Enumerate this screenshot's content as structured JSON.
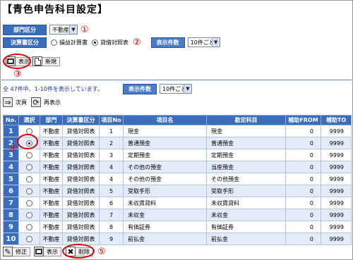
{
  "page_title": "【青色申告科目設定】",
  "filter": {
    "dept_label": "部門区分",
    "dept_value": "不動産",
    "report_label": "決算書区分",
    "report_options": [
      {
        "label": "損益計算書",
        "selected": false
      },
      {
        "label": "貸借対照表",
        "selected": true
      }
    ],
    "count_label": "表示件数",
    "count_value": "10件ごと"
  },
  "annotations": {
    "n1": "①",
    "n2": "②",
    "n3": "③",
    "n4": "④",
    "n5": "⑤"
  },
  "top_buttons": {
    "display": "表示",
    "new": "新規"
  },
  "list_info": {
    "summary": "全 47件中、1-10件を表示しています。",
    "count_label": "表示件数",
    "count_value": "10件ごと",
    "next": "次頁",
    "redisplay": "再表示"
  },
  "table": {
    "headers": [
      "No.",
      "選択",
      "部門",
      "決算書区分",
      "項目No",
      "項目名",
      "勘定科目",
      "補助FROM",
      "補助TO"
    ],
    "rows": [
      {
        "no": "1",
        "selected": false,
        "dept": "不動産",
        "report": "貸借対照表",
        "item_no": "1",
        "item_name": "現金",
        "account": "現金",
        "from": "0",
        "to": "9999"
      },
      {
        "no": "2",
        "selected": true,
        "dept": "不動産",
        "report": "貸借対照表",
        "item_no": "2",
        "item_name": "普通預金",
        "account": "普通預金",
        "from": "0",
        "to": "9999"
      },
      {
        "no": "3",
        "selected": false,
        "dept": "不動産",
        "report": "貸借対照表",
        "item_no": "3",
        "item_name": "定期預金",
        "account": "定期預金",
        "from": "0",
        "to": "9999"
      },
      {
        "no": "4",
        "selected": false,
        "dept": "不動産",
        "report": "貸借対照表",
        "item_no": "4",
        "item_name": "その他の預金",
        "account": "当座預金",
        "from": "0",
        "to": "9999"
      },
      {
        "no": "5",
        "selected": false,
        "dept": "不動産",
        "report": "貸借対照表",
        "item_no": "4",
        "item_name": "その他の預金",
        "account": "その他預金",
        "from": "0",
        "to": "9999"
      },
      {
        "no": "6",
        "selected": false,
        "dept": "不動産",
        "report": "貸借対照表",
        "item_no": "5",
        "item_name": "受取手形",
        "account": "受取手形",
        "from": "0",
        "to": "9999"
      },
      {
        "no": "7",
        "selected": false,
        "dept": "不動産",
        "report": "貸借対照表",
        "item_no": "6",
        "item_name": "未収賃貸料",
        "account": "未収賃貸料",
        "from": "0",
        "to": "9999"
      },
      {
        "no": "8",
        "selected": false,
        "dept": "不動産",
        "report": "貸借対照表",
        "item_no": "7",
        "item_name": "未収金",
        "account": "未収金",
        "from": "0",
        "to": "9999"
      },
      {
        "no": "9",
        "selected": false,
        "dept": "不動産",
        "report": "貸借対照表",
        "item_no": "8",
        "item_name": "有価証券",
        "account": "有価証券",
        "from": "0",
        "to": "9999"
      },
      {
        "no": "10",
        "selected": false,
        "dept": "不動産",
        "report": "貸借対照表",
        "item_no": "9",
        "item_name": "前払金",
        "account": "前払金",
        "from": "0",
        "to": "9999"
      }
    ]
  },
  "bottom_buttons": {
    "edit": "修正",
    "display": "表示",
    "delete": "削除"
  }
}
